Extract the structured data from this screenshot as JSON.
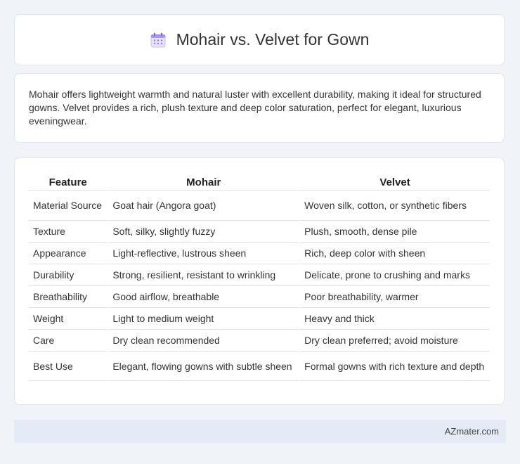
{
  "header": {
    "title": "Mohair vs. Velvet for Gown",
    "icon": "calendar-icon"
  },
  "description": "Mohair offers lightweight warmth and natural luster with excellent durability, making it ideal for structured gowns. Velvet provides a rich, plush texture and deep color saturation, perfect for elegant, luxurious eveningwear.",
  "table": {
    "headers": [
      "Feature",
      "Mohair",
      "Velvet"
    ],
    "rows": [
      [
        "Material Source",
        "Goat hair (Angora goat)",
        "Woven silk, cotton, or synthetic fibers"
      ],
      [
        "Texture",
        "Soft, silky, slightly fuzzy",
        "Plush, smooth, dense pile"
      ],
      [
        "Appearance",
        "Light-reflective, lustrous sheen",
        "Rich, deep color with sheen"
      ],
      [
        "Durability",
        "Strong, resilient, resistant to wrinkling",
        "Delicate, prone to crushing and marks"
      ],
      [
        "Breathability",
        "Good airflow, breathable",
        "Poor breathability, warmer"
      ],
      [
        "Weight",
        "Light to medium weight",
        "Heavy and thick"
      ],
      [
        "Care",
        "Dry clean recommended",
        "Dry clean preferred; avoid moisture"
      ],
      [
        "Best Use",
        "Elegant, flowing gowns with subtle sheen",
        "Formal gowns with rich texture and depth"
      ]
    ]
  },
  "footer": {
    "brand": "AZmater.com"
  }
}
